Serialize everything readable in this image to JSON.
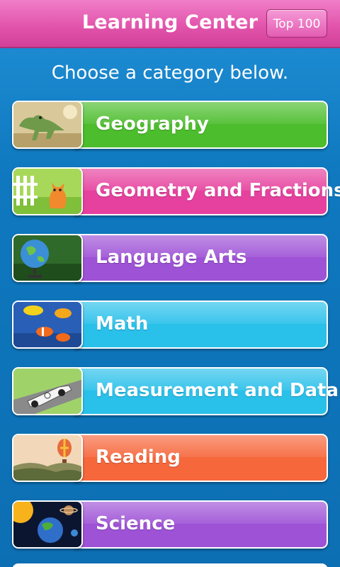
{
  "header": {
    "title": "Learning Center",
    "top_button": "Top 100"
  },
  "subtitle": "Choose a category below.",
  "categories": [
    {
      "label": "Geography",
      "color": "#4cbd2c",
      "icon": "dinosaur-icon"
    },
    {
      "label": "Geometry and Fractions",
      "color": "#e6419e",
      "icon": "cat-fence-icon"
    },
    {
      "label": "Language Arts",
      "color": "#9e52d6",
      "icon": "globe-icon"
    },
    {
      "label": "Math",
      "color": "#29c0ea",
      "icon": "fish-icon"
    },
    {
      "label": "Measurement and Data",
      "color": "#29c0ea",
      "icon": "race-car-icon"
    },
    {
      "label": "Reading",
      "color": "#f6673c",
      "icon": "hot-air-balloon-icon"
    },
    {
      "label": "Science",
      "color": "#9e52d6",
      "icon": "solar-system-icon"
    }
  ]
}
